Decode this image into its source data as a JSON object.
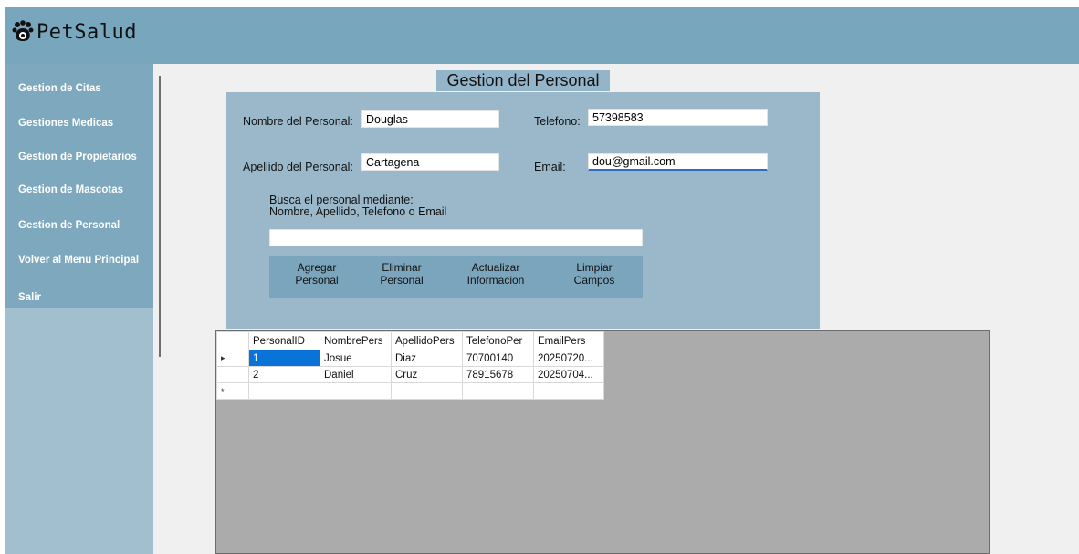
{
  "app": {
    "name": "PetSalud"
  },
  "sidebar": {
    "items": [
      {
        "label": "Gestion de Citas"
      },
      {
        "label": "Gestiones Medicas"
      },
      {
        "label": "Gestion de Propietarios"
      },
      {
        "label": "Gestion de Mascotas"
      },
      {
        "label": "Gestion de Personal"
      },
      {
        "label": "Volver al Menu Principal"
      },
      {
        "label": "Salir"
      }
    ]
  },
  "page": {
    "title": "Gestion del Personal"
  },
  "form": {
    "nombre_label": "Nombre del Personal:",
    "nombre_value": "Douglas",
    "apellido_label": "Apellido del Personal:",
    "apellido_value": "Cartagena",
    "telefono_label": "Telefono:",
    "telefono_value": "57398583",
    "email_label": "Email:",
    "email_value": "dou@gmail.com",
    "search_hint_line1": "Busca el personal mediante:",
    "search_hint_line2": "Nombre, Apellido, Telefono o Email",
    "search_value": ""
  },
  "buttons": {
    "agregar": [
      "Agregar",
      "Personal"
    ],
    "eliminar": [
      "Eliminar",
      "Personal"
    ],
    "actualizar": [
      "Actualizar",
      "Informacion"
    ],
    "limpiar": [
      "Limpiar",
      "Campos"
    ]
  },
  "grid": {
    "columns": [
      "PersonalID",
      "NombrePers",
      "ApellidoPers",
      "TelefonoPer",
      "EmailPers"
    ],
    "rows": [
      {
        "indicator": "▸",
        "cells": [
          "1",
          "Josue",
          "Diaz",
          "70700140",
          "20250720..."
        ]
      },
      {
        "indicator": "",
        "cells": [
          "2",
          "Daniel",
          "Cruz",
          "78915678",
          "20250704..."
        ]
      },
      {
        "indicator": "*",
        "cells": [
          "",
          "",
          "",
          "",
          ""
        ]
      }
    ]
  },
  "colors": {
    "header": "#78a6bd",
    "sidebar": "#7ea8bd",
    "panel": "#9ab8ca",
    "button_bar": "#7aa5bc",
    "selection": "#0a73d8"
  }
}
